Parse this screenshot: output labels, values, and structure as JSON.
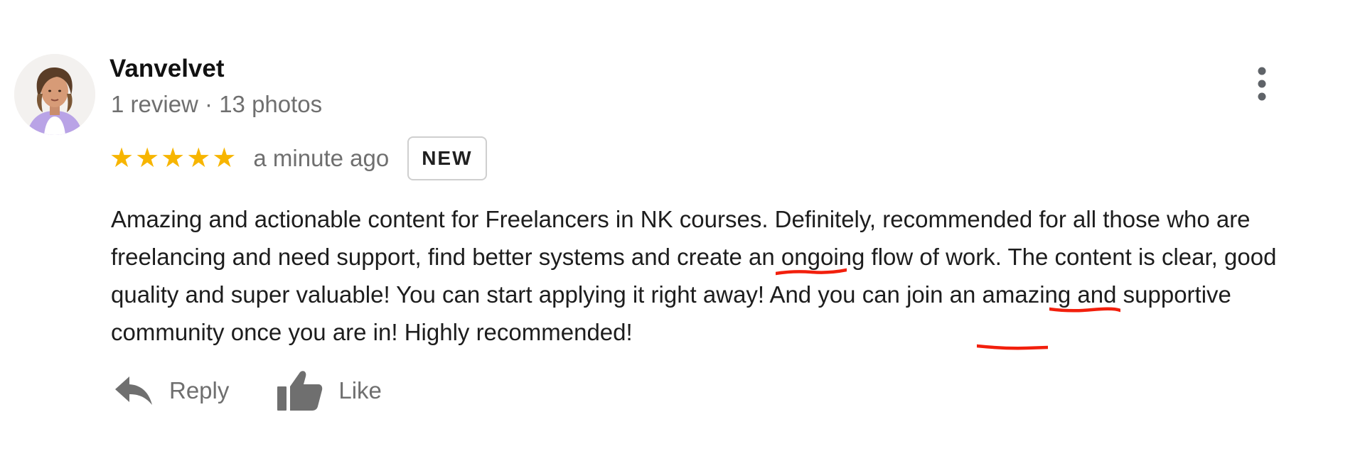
{
  "review": {
    "author": {
      "name": "Vanvelvet",
      "meta": "1 review · 13 photos"
    },
    "rating": 5,
    "stars": [
      "★",
      "★",
      "★",
      "★",
      "★"
    ],
    "time_ago": "a minute ago",
    "badge": "NEW",
    "text": {
      "p1": "Amazing and actionable content for Freelancers in NK courses. Definitely, recommended for all those who are freelancing and need support, find better systems and create an ",
      "hl1": "ongoing flow of work.",
      "p2": " The ",
      "hl2": "content is clear, good quality and super valuable",
      "p3": "! You can start applying it right away! And you can join an ",
      "hl3": "amazing and supportive community",
      "p4": " once you are in! Highly recommended!"
    },
    "actions": {
      "reply_label": "Reply",
      "like_label": "Like"
    }
  },
  "colors": {
    "star": "#f7b500",
    "underline": "#f21f0c",
    "secondary_text": "#6f6f6f"
  },
  "icons": {
    "more": "more-vertical-icon",
    "reply": "reply-arrow-icon",
    "like": "thumbs-up-icon"
  }
}
